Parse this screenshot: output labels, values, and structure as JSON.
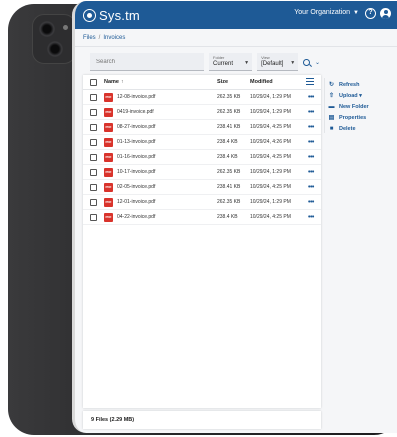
{
  "app": {
    "title": "Sys.tm",
    "organization": "Your Organization",
    "help_glyph": "?"
  },
  "breadcrumb": [
    "Files",
    "Invoices"
  ],
  "breadcrumb_sep": "/",
  "toolbar": {
    "search_placeholder": "Search",
    "folder_label": "Folder",
    "folder_value": "Current",
    "view_label": "View",
    "view_value": "[Default]"
  },
  "table": {
    "columns": [
      "Name",
      "Size",
      "Modified"
    ],
    "sort_glyph": "↑",
    "rows": [
      {
        "name": "12-08-invoice.pdf",
        "size": "262.35 KB",
        "modified": "10/29/24, 1:29 PM"
      },
      {
        "name": "0419-invoice.pdf",
        "size": "262.35 KB",
        "modified": "10/29/24, 1:29 PM"
      },
      {
        "name": "08-27-invoice.pdf",
        "size": "238.41 KB",
        "modified": "10/29/24, 4:25 PM"
      },
      {
        "name": "01-13-invoice.pdf",
        "size": "238.4 KB",
        "modified": "10/29/24, 4:26 PM"
      },
      {
        "name": "01-16-invoice.pdf",
        "size": "238.4 KB",
        "modified": "10/29/24, 4:25 PM"
      },
      {
        "name": "10-17-invoice.pdf",
        "size": "262.35 KB",
        "modified": "10/29/24, 1:29 PM"
      },
      {
        "name": "02-05-invoice.pdf",
        "size": "238.41 KB",
        "modified": "10/29/24, 4:25 PM"
      },
      {
        "name": "12-01-invoice.pdf",
        "size": "262.35 KB",
        "modified": "10/29/24, 1:29 PM"
      },
      {
        "name": "04-22-invoice.pdf",
        "size": "238.4 KB",
        "modified": "10/29/24, 4:25 PM"
      }
    ],
    "file_badge": "PDF",
    "more_glyph": "•••"
  },
  "footer": {
    "summary": "9 Files (2.29 MB)"
  },
  "actions": [
    {
      "label": "Refresh",
      "icon": "refresh-icon",
      "glyph": "↻"
    },
    {
      "label": "Upload ▾",
      "icon": "upload-icon",
      "glyph": "⇧"
    },
    {
      "label": "New Folder",
      "icon": "new-folder-icon",
      "glyph": "▬"
    },
    {
      "label": "Properties",
      "icon": "properties-icon",
      "glyph": "▤"
    },
    {
      "label": "Delete",
      "icon": "delete-icon",
      "glyph": "■"
    }
  ],
  "colors": {
    "accent": "#1e5a96",
    "pdf": "#d9332b"
  }
}
